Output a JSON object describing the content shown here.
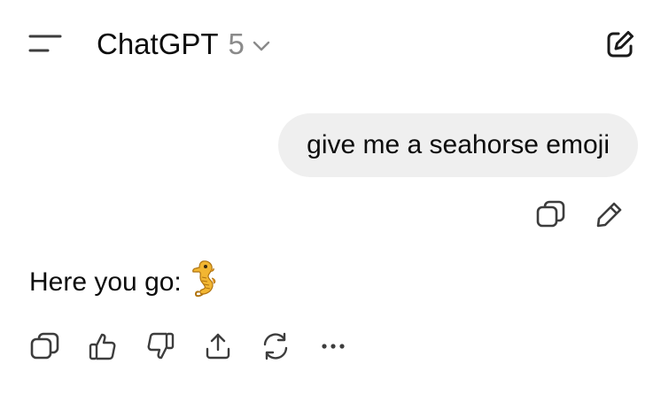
{
  "header": {
    "title": "ChatGPT",
    "version": "5",
    "menu_icon": "sidebar-menu-icon",
    "model_dropdown_icon": "chevron-down-icon",
    "new_chat_icon": "edit-square-icon"
  },
  "conversation": {
    "user_message": "give me a seahorse emoji",
    "user_actions": [
      "copy-icon",
      "edit-pencil-icon"
    ],
    "assistant_message": "Here you go:",
    "assistant_emoji": "seahorse-emoji",
    "assistant_actions": [
      "copy-icon",
      "thumbs-up-icon",
      "thumbs-down-icon",
      "share-icon",
      "regenerate-icon",
      "more-icon"
    ]
  },
  "colors": {
    "text": "#0d0d0d",
    "muted": "#8a8a8a",
    "bubble": "#efefef",
    "icon": "#3d3d3d"
  }
}
